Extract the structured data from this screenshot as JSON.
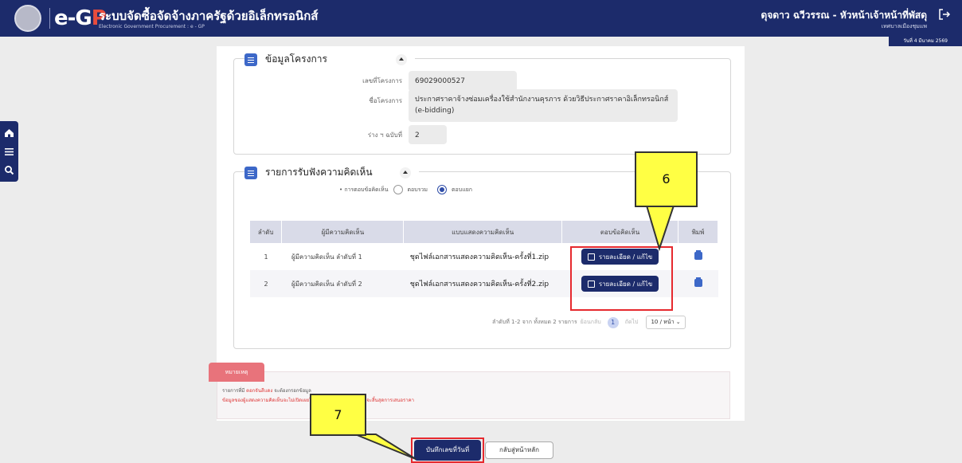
{
  "header": {
    "logo_text": "e-GP",
    "title": "ระบบจัดซื้อจัดจ้างภาครัฐด้วยอิเล็กทรอนิกส์",
    "subtitle": "Electronic Government Procurement : e - GP",
    "user_name": "ดุจดาว ฉวีวรรณ - หัวหน้าเจ้าหน้าที่พัสดุ",
    "user_org": "เทศบาลเมืองชุมแพ",
    "date": "วันที่ 4 มีนาคม 2569"
  },
  "sidebar": {
    "icons": [
      "home-icon",
      "menu-icon",
      "search-icon"
    ]
  },
  "project": {
    "section_title": "ข้อมูลโครงการ",
    "project_no_label": "เลขที่โครงการ",
    "project_no": "69029000527",
    "project_name_label": "ชื่อโครงการ",
    "project_name": "ประกาศราคาจ้างซ่อมเครื่องใช้สำนักงานคุรภาร ด้วยวิธีประกาศราคาอิเล็กทรอนิกส์ (e-bidding)",
    "draft_label": "ร่าง ฯ ฉบับที่",
    "draft_no": "2"
  },
  "comments": {
    "section_title": "รายการรับฟังความคิดเห็น",
    "answer_mode_label": "• การตอบข้อคิดเห็น",
    "option_combined": "ตอบรวม",
    "option_separate": "ตอบแยก",
    "selected": "ตอบแยก",
    "columns": [
      "ลำดับ",
      "ผู้มีความคิดเห็น",
      "แบบแสดงความคิดเห็น",
      "ตอบข้อคิดเห็น",
      "พิมพ์"
    ],
    "rows": [
      {
        "no": "1",
        "commenter": "ผู้มีความคิดเห็น ลำดับที่ 1",
        "file": "ชุดไฟล์เอกสารแสดงความคิดเห็น-ครั้งที่1.zip",
        "action": "รายละเอียด / แก้ไข"
      },
      {
        "no": "2",
        "commenter": "ผู้มีความคิดเห็น ลำดับที่ 2",
        "file": "ชุดไฟล์เอกสารแสดงความคิดเห็น-ครั้งที่2.zip",
        "action": "รายละเอียด / แก้ไข"
      }
    ],
    "pager": {
      "summary": "ลำดับที่ 1-2 จาก ทั้งหมด 2 รายการ",
      "prev": "ย้อนกลับ",
      "page": "1",
      "next": "ถัดไป",
      "page_size": "10 / หน้า"
    }
  },
  "note": {
    "tab_label": "หมายเหตุ",
    "line1_prefix": "รายการที่มี",
    "line1_red": "ตอกจันสีแดง",
    "line1_suffix": "จะต้องกรอกข้อมูล",
    "line2": "ข้อมูลของผู้แสดงความคิดเห็นจะไม่เปิดเผยให้สาธารณชนทราบ จนกว่าจะสิ้นสุดการเสนอราคา"
  },
  "actions": {
    "save_label": "บันทึกเลขที่วันที่",
    "back_label": "กลับสู่หน้าหลัก"
  },
  "annotations": {
    "callout_6": "6",
    "callout_7": "7"
  },
  "colors": {
    "navy": "#1c2b6b",
    "accent_blue": "#3d68c8",
    "highlight_red": "#e6292e",
    "callout_yellow": "#ffff44"
  }
}
